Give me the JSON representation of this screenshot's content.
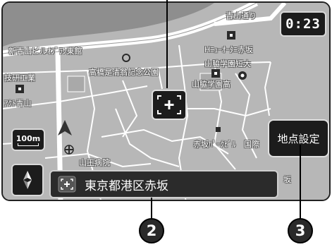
{
  "status": {
    "clock": "0:23"
  },
  "map": {
    "labels": [
      {
        "key": "street",
        "text": "青山通り"
      },
      {
        "key": "building-west",
        "text": "新青山ビルｵﾌﾞﾗﾝ東館"
      },
      {
        "key": "factory",
        "text": "技研工業"
      },
      {
        "key": "hotel",
        "text": "Hﾆｭｰｵｰﾀﾆ赤坂"
      },
      {
        "key": "school-east",
        "text": "山脇学園短大"
      },
      {
        "key": "memorial-park",
        "text": "高橋是清翁記念公園"
      },
      {
        "key": "school",
        "text": "山脇学園高"
      },
      {
        "key": "tower",
        "text": "ｱｸﾄ青山"
      },
      {
        "key": "akasaka-park",
        "text": "赤坂ﾊﾟｰｸﾋﾞﾙ"
      },
      {
        "key": "national",
        "text": "国際"
      },
      {
        "key": "hospital",
        "text": "山王病院"
      },
      {
        "key": "sakaba",
        "text": "坂"
      }
    ]
  },
  "controls": {
    "scale": "100m",
    "point_button": "地点設定"
  },
  "address_bar": {
    "text": "東京都港区赤坂"
  },
  "callouts": {
    "left": "2",
    "right": "3"
  }
}
